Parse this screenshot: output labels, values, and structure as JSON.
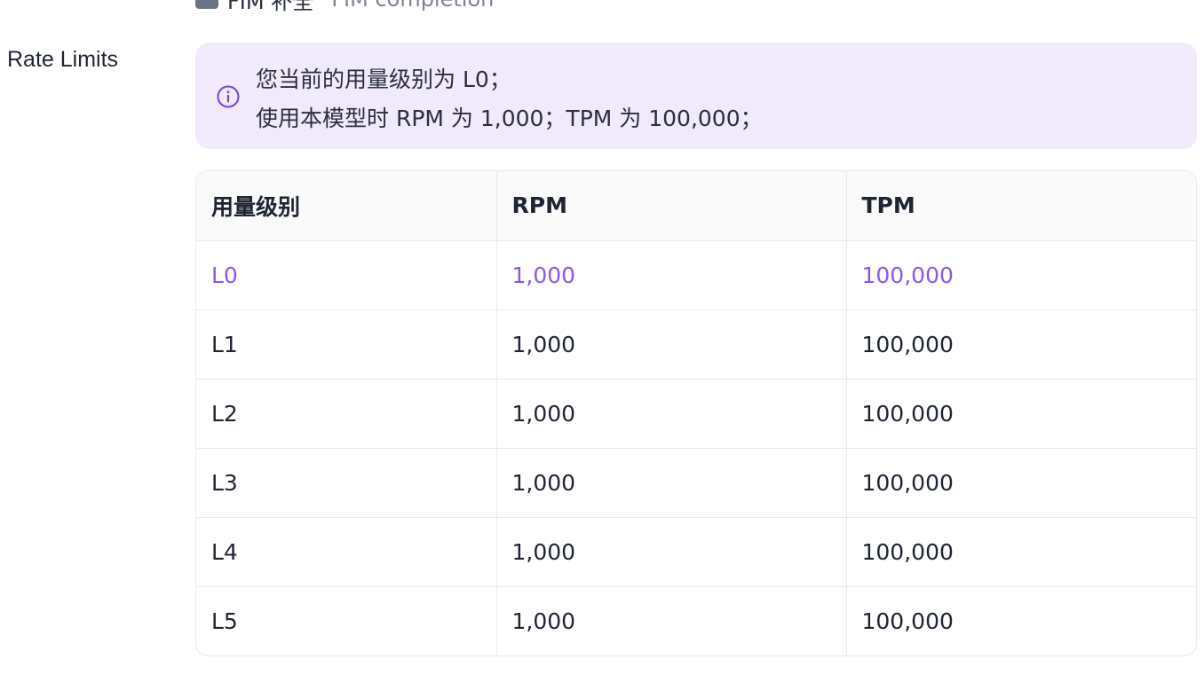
{
  "top_row": {
    "label": "FIM 补全",
    "description": "FIM completion"
  },
  "rate_limits": {
    "section_label": "Rate Limits",
    "notice": {
      "icon": "info-icon",
      "line1": "您当前的用量级别为 L0；",
      "line2": "使用本模型时 RPM 为 1,000；TPM 为 100,000；"
    },
    "table": {
      "headers": [
        "用量级别",
        "RPM",
        "TPM"
      ],
      "rows": [
        {
          "level": "L0",
          "rpm": "1,000",
          "tpm": "100,000",
          "current": true
        },
        {
          "level": "L1",
          "rpm": "1,000",
          "tpm": "100,000",
          "current": false
        },
        {
          "level": "L2",
          "rpm": "1,000",
          "tpm": "100,000",
          "current": false
        },
        {
          "level": "L3",
          "rpm": "1,000",
          "tpm": "100,000",
          "current": false
        },
        {
          "level": "L4",
          "rpm": "1,000",
          "tpm": "100,000",
          "current": false
        },
        {
          "level": "L5",
          "rpm": "1,000",
          "tpm": "100,000",
          "current": false
        }
      ]
    }
  },
  "colors": {
    "accent": "#8b57e6",
    "notice_bg": "#f1eafb",
    "border": "#e9eaee"
  }
}
